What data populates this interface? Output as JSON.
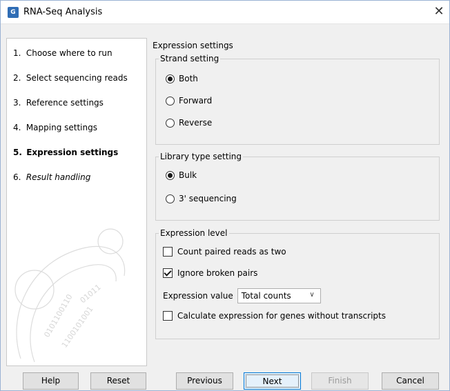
{
  "window": {
    "title": "RNA-Seq Analysis",
    "icon": "clc-app-icon",
    "close_glyph": "✕"
  },
  "steps": [
    {
      "num": "1.",
      "label": "Choose where to run",
      "state": "normal"
    },
    {
      "num": "2.",
      "label": "Select sequencing reads",
      "state": "normal"
    },
    {
      "num": "3.",
      "label": "Reference settings",
      "state": "normal"
    },
    {
      "num": "4.",
      "label": "Mapping settings",
      "state": "normal"
    },
    {
      "num": "5.",
      "label": "Expression settings",
      "state": "active"
    },
    {
      "num": "6.",
      "label": "Result handling",
      "state": "italic"
    }
  ],
  "content": {
    "title": "Expression settings",
    "strand": {
      "legend": "Strand setting",
      "options": [
        {
          "label": "Both",
          "checked": true
        },
        {
          "label": "Forward",
          "checked": false
        },
        {
          "label": "Reverse",
          "checked": false
        }
      ]
    },
    "library": {
      "legend": "Library type setting",
      "options": [
        {
          "label": "Bulk",
          "checked": true
        },
        {
          "label": "3' sequencing",
          "checked": false
        }
      ]
    },
    "expression": {
      "legend": "Expression level",
      "count_paired": {
        "label": "Count paired reads as two",
        "checked": false
      },
      "ignore_broken": {
        "label": "Ignore broken pairs",
        "checked": true
      },
      "value_label": "Expression value",
      "value_selected": "Total counts",
      "calc_without": {
        "label": "Calculate expression for genes without transcripts",
        "checked": false
      }
    }
  },
  "buttons": {
    "help": "Help",
    "reset": "Reset",
    "previous": "Previous",
    "next": "Next",
    "finish": "Finish",
    "cancel": "Cancel"
  }
}
